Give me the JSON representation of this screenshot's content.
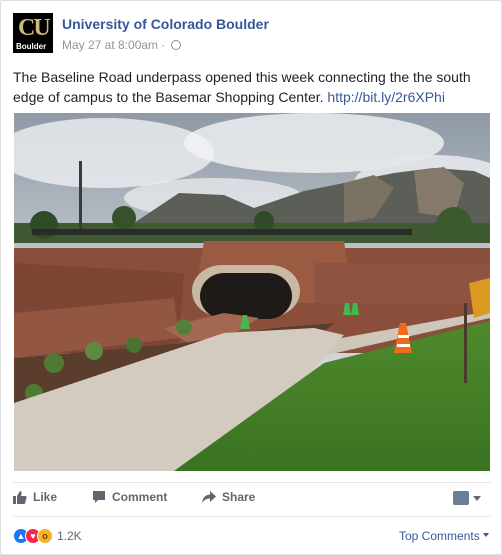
{
  "post": {
    "page_name": "University of Colorado Boulder",
    "logo_text": "CU",
    "logo_caption": "Boulder",
    "timestamp": "May 27 at 8:00am",
    "separator": "·",
    "body_text": "The Baseline Road underpass opened this week connecting the the south edge of campus to the Basemar Shopping Center. ",
    "link_text": "http://bit.ly/2r6XPhi"
  },
  "actions": {
    "like_label": "Like",
    "comment_label": "Comment",
    "share_label": "Share"
  },
  "footer": {
    "reaction_count": "1.2K",
    "top_comments_label": "Top Comments"
  },
  "icons": {
    "globe": "globe-icon",
    "like": "thumbs-up-icon",
    "comment": "comment-bubble-icon",
    "share": "share-arrow-icon",
    "reactions": [
      "like-reaction-icon",
      "love-reaction-icon",
      "wow-reaction-icon"
    ]
  },
  "colors": {
    "link": "#365899",
    "secondary_text": "#90949c",
    "action_text": "#616770"
  }
}
